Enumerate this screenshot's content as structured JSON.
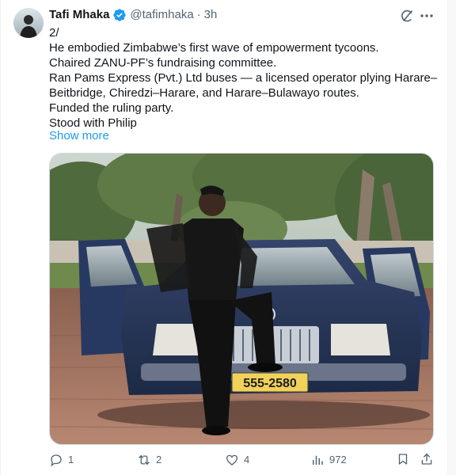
{
  "tweet": {
    "author": {
      "name": "Tafi Mhaka",
      "handle": "@tafimhaka",
      "separator": "·",
      "time": "3h",
      "verified": true
    },
    "lines": [
      "2/",
      "He embodied Zimbabwe’s first wave of empowerment tycoons.",
      "Chaired ZANU-PF’s fundraising committee.",
      "Ran Pams Express (Pvt.) Ltd buses — a licensed operator plying Harare–",
      "Beitbridge, Chiredzi–Harare, and Harare–Bulawayo routes.",
      "Funded the ruling party.",
      "Stood with Philip"
    ],
    "show_more": "Show more",
    "media": {
      "plate": "555-2580"
    },
    "stats": {
      "replies": "1",
      "reposts": "2",
      "likes": "4",
      "views": "972"
    }
  },
  "icons": {
    "verified": "verified-badge-icon",
    "grok": "grok-icon",
    "more": "more-dots-icon",
    "reply": "reply-icon",
    "repost": "repost-icon",
    "like": "heart-icon",
    "views": "views-icon",
    "bookmark": "bookmark-icon",
    "share": "share-icon"
  },
  "colors": {
    "accent": "#1d9bf0",
    "muted": "#536471",
    "text": "#0f1419",
    "border": "#cfd9de"
  }
}
